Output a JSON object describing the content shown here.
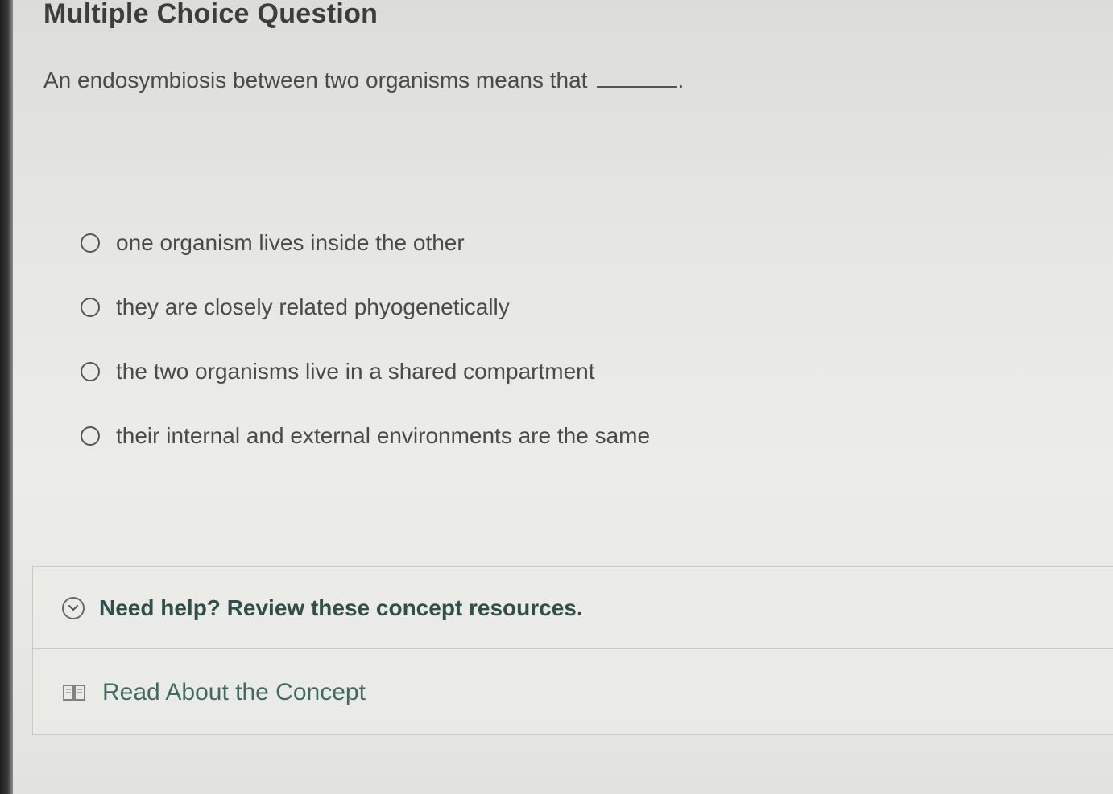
{
  "header": {
    "title": "Multiple Choice Question"
  },
  "question": {
    "text": "An endosymbiosis between two organisms means that",
    "suffix": "."
  },
  "options": [
    {
      "label": "one organism lives inside the other"
    },
    {
      "label": "they are closely related phyogenetically"
    },
    {
      "label": "the two organisms live in a shared compartment"
    },
    {
      "label": "their internal and external environments are the same"
    }
  ],
  "help": {
    "title": "Need help? Review these concept resources.",
    "icon": "chevron-down-circle-icon",
    "resources": [
      {
        "label": "Read About the Concept",
        "icon": "book-icon"
      }
    ]
  },
  "colors": {
    "help_text": "#2f4f4a",
    "resource_link": "#3f6a64",
    "body_text": "#4a4a4a"
  }
}
